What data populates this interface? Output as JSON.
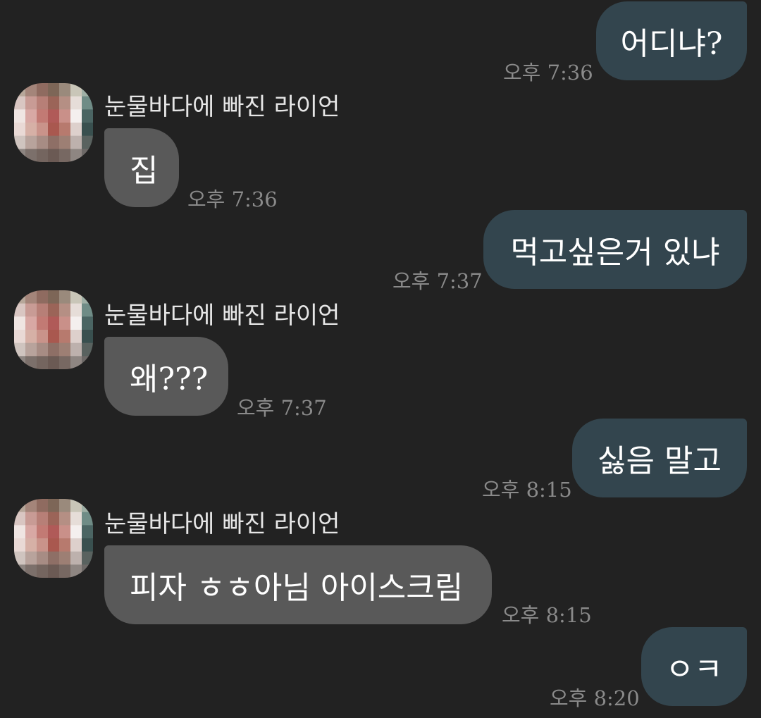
{
  "colors": {
    "background": "#222222",
    "sent_bubble": "#33454e",
    "received_bubble": "#595959",
    "timestamp": "#8a8a8a",
    "text": "#ffffff"
  },
  "messages": [
    {
      "direction": "sent",
      "text": "어디냐?",
      "time": "오후 7:36"
    },
    {
      "direction": "received",
      "sender": "눈물바다에 빠진 라이언",
      "avatar": "pixelated-profile-photo",
      "text": "집",
      "time": "오후 7:36"
    },
    {
      "direction": "sent",
      "text": "먹고싶은거 있냐",
      "time": "오후 7:37"
    },
    {
      "direction": "received",
      "sender": "눈물바다에 빠진 라이언",
      "avatar": "pixelated-profile-photo",
      "text": "왜???",
      "time": "오후 7:37"
    },
    {
      "direction": "sent",
      "text": "싫음 말고",
      "time": "오후 8:15"
    },
    {
      "direction": "received",
      "sender": "눈물바다에 빠진 라이언",
      "avatar": "pixelated-profile-photo",
      "text": "피자 ㅎㅎ아님 아이스크림",
      "time": "오후 8:15"
    },
    {
      "direction": "sent",
      "text": "ㅇㅋ",
      "time": "오후 8:20"
    }
  ]
}
